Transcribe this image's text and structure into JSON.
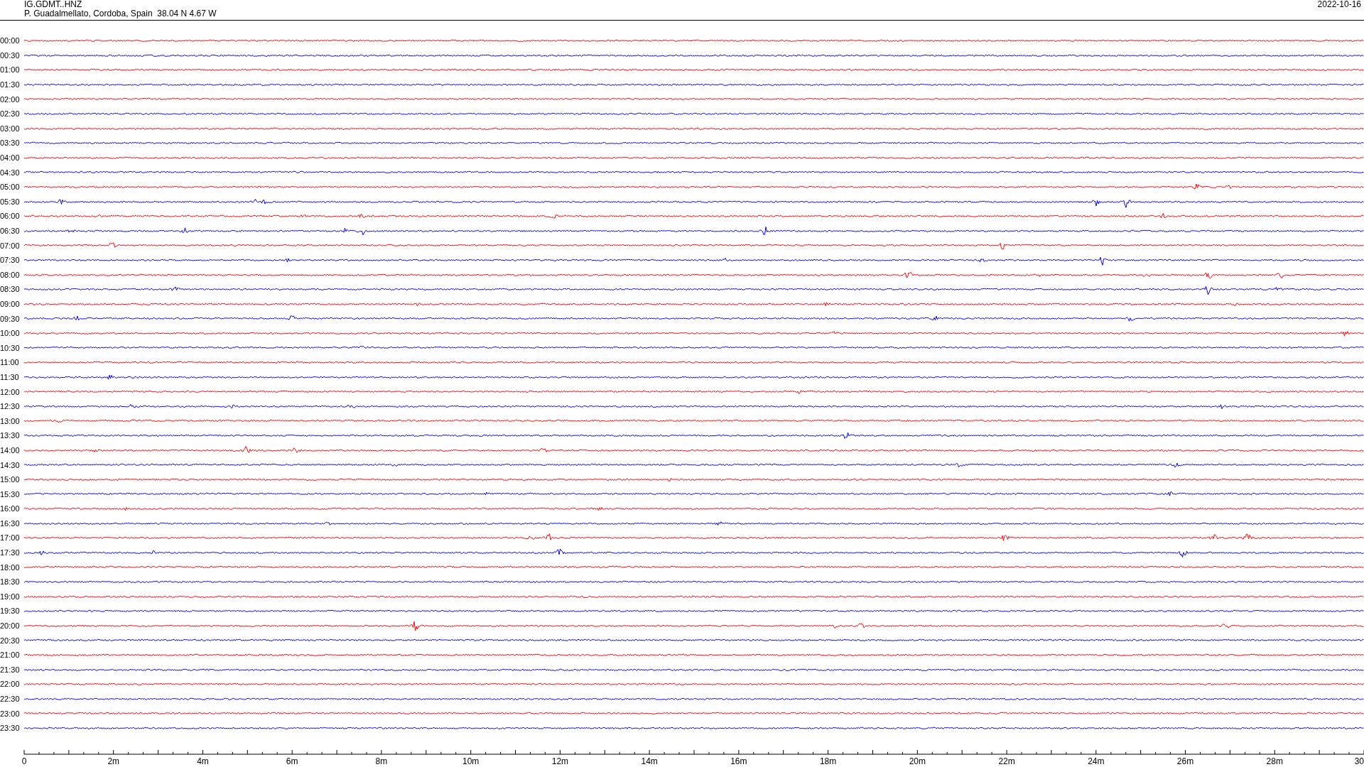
{
  "header": {
    "station": "IG.GDMT..HNZ",
    "location": "P. Guadalmellato, Cordoba, Spain  38.04 N 4.67 W",
    "date": "2022-10-16"
  },
  "traces": [
    {
      "time": "00:00",
      "color": "#ff0000"
    },
    {
      "time": "00:30",
      "color": "#0000ff"
    },
    {
      "time": "01:00",
      "color": "#ff0000"
    },
    {
      "time": "01:30",
      "color": "#0000ff"
    },
    {
      "time": "02:00",
      "color": "#ff0000"
    },
    {
      "time": "02:30",
      "color": "#0000ff"
    },
    {
      "time": "03:00",
      "color": "#ff0000"
    },
    {
      "time": "03:30",
      "color": "#0000ff"
    },
    {
      "time": "04:00",
      "color": "#ff0000"
    },
    {
      "time": "04:30",
      "color": "#0000ff"
    },
    {
      "time": "05:00",
      "color": "#ff0000"
    },
    {
      "time": "05:30",
      "color": "#0000ff"
    },
    {
      "time": "06:00",
      "color": "#ff0000"
    },
    {
      "time": "06:30",
      "color": "#0000ff"
    },
    {
      "time": "07:00",
      "color": "#ff0000"
    },
    {
      "time": "07:30",
      "color": "#0000ff"
    },
    {
      "time": "08:00",
      "color": "#ff0000"
    },
    {
      "time": "08:30",
      "color": "#0000ff"
    },
    {
      "time": "09:00",
      "color": "#ff0000"
    },
    {
      "time": "09:30",
      "color": "#0000ff"
    },
    {
      "time": "10:00",
      "color": "#ff0000"
    },
    {
      "time": "10:30",
      "color": "#0000ff"
    },
    {
      "time": "11:00",
      "color": "#ff0000"
    },
    {
      "time": "11:30",
      "color": "#0000ff"
    },
    {
      "time": "12:00",
      "color": "#ff0000"
    },
    {
      "time": "12:30",
      "color": "#0000ff"
    },
    {
      "time": "13:00",
      "color": "#ff0000"
    },
    {
      "time": "13:30",
      "color": "#0000ff"
    },
    {
      "time": "14:00",
      "color": "#ff0000"
    },
    {
      "time": "14:30",
      "color": "#0000ff"
    },
    {
      "time": "15:00",
      "color": "#ff0000"
    },
    {
      "time": "15:30",
      "color": "#0000ff"
    },
    {
      "time": "16:00",
      "color": "#ff0000"
    },
    {
      "time": "16:30",
      "color": "#0000ff"
    },
    {
      "time": "17:00",
      "color": "#ff0000"
    },
    {
      "time": "17:30",
      "color": "#0000ff"
    },
    {
      "time": "18:00",
      "color": "#ff0000"
    },
    {
      "time": "18:30",
      "color": "#0000ff"
    },
    {
      "time": "19:00",
      "color": "#ff0000"
    },
    {
      "time": "19:30",
      "color": "#0000ff"
    },
    {
      "time": "20:00",
      "color": "#ff0000"
    },
    {
      "time": "20:30",
      "color": "#0000ff"
    },
    {
      "time": "21:00",
      "color": "#ff0000"
    },
    {
      "time": "21:30",
      "color": "#0000ff"
    },
    {
      "time": "22:00",
      "color": "#ff0000"
    },
    {
      "time": "22:30",
      "color": "#0000ff"
    },
    {
      "time": "23:00",
      "color": "#ff0000"
    },
    {
      "time": "23:30",
      "color": "#0000ff"
    }
  ],
  "axis": {
    "ticks": [
      "0",
      "2m",
      "4m",
      "6m",
      "8m",
      "10m",
      "12m",
      "14m",
      "16m",
      "18m",
      "20m",
      "22m",
      "24m",
      "26m",
      "28m",
      "30"
    ]
  }
}
